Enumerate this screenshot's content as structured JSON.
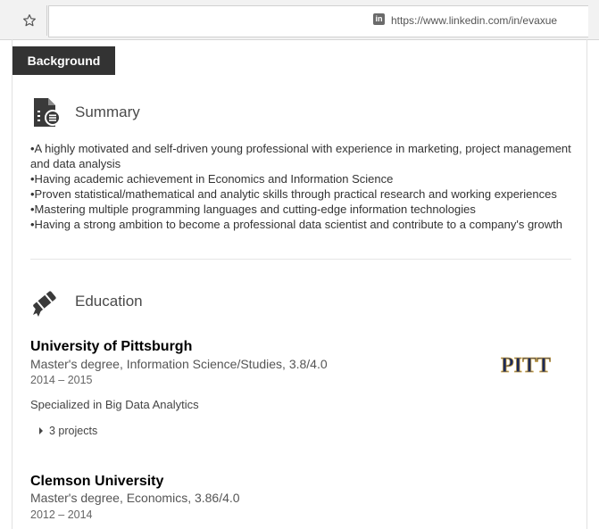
{
  "browser": {
    "url": "https://www.linkedin.com/in/evaxue",
    "site_icon": "linkedin-icon",
    "star_icon": "star-icon"
  },
  "tab": {
    "label": "Background"
  },
  "summary": {
    "title": "Summary",
    "icon": "document-list-icon",
    "lines": [
      "•A highly motivated and self-driven young professional with experience in marketing, project management and data analysis",
      "•Having academic achievement in Economics and Information Science",
      "•Proven statistical/mathematical and analytic skills through practical research and working experiences",
      "•Mastering multiple programming languages and cutting-edge information technologies",
      "•Having a strong ambition to become a professional data scientist and contribute to a company's growth"
    ]
  },
  "education": {
    "title": "Education",
    "icon": "diploma-icon",
    "schools": [
      {
        "name": "University of Pittsburgh",
        "degree": "Master's degree, Information Science/Studies, 3.8/4.0",
        "dates": "2014 – 2015",
        "note": "Specialized in Big Data Analytics",
        "projects_label": "3 projects",
        "logo_text": "PITT"
      },
      {
        "name": "Clemson University",
        "degree": "Master's degree, Economics, 3.86/4.0",
        "dates": "2012 – 2014"
      }
    ]
  },
  "colors": {
    "tab_bg": "#333333",
    "pitt_navy": "#1c2a5a",
    "pitt_gold": "#c8a24a"
  }
}
